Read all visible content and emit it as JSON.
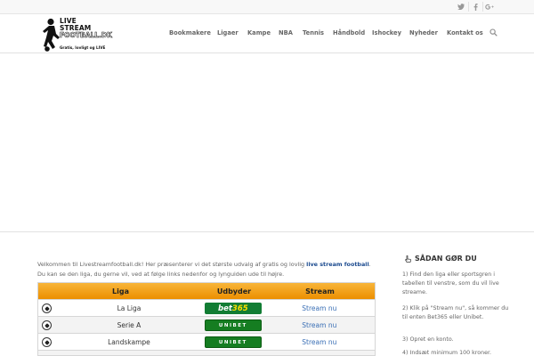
{
  "topbar": {
    "social": [
      {
        "name": "twitter-icon",
        "glyph": "t"
      },
      {
        "name": "facebook-icon",
        "glyph": "f"
      },
      {
        "name": "google-plus-icon",
        "glyph": "g+"
      }
    ]
  },
  "logo": {
    "line1": "LIVE",
    "line2": "STREAM",
    "line3": "FOOTBALL.DK",
    "tagline": "Gratis, lovligt og LIVE"
  },
  "nav": {
    "items": [
      "Bookmakere",
      "Ligaer",
      "Kampe",
      "NBA",
      "Tennis",
      "Håndbold",
      "Ishockey",
      "Nyheder",
      "Kontakt os"
    ]
  },
  "intro": {
    "before": "Velkommen til Livestreamfootball.dk! Her præsenterer vi det største udvalg af gratis og lovlig ",
    "highlight": "live stream football",
    "after": ". Du kan se den liga, du gerne vil, ved at følge links nedenfor og lynguiden ude til højre."
  },
  "table": {
    "headers": [
      "Liga",
      "Udbyder",
      "Stream"
    ],
    "rows": [
      {
        "liga": "La Liga",
        "udbyder": "bet365",
        "stream": "Stream nu"
      },
      {
        "liga": "Serie A",
        "udbyder": "UNIBET",
        "stream": "Stream nu"
      },
      {
        "liga": "Landskampe",
        "udbyder": "UNIBET",
        "stream": "Stream nu"
      }
    ]
  },
  "sidebar": {
    "title": "SÅDAN GØR DU",
    "steps": [
      "1) Find den liga eller sportsgren i tabellen til venstre, som du vil live streame.",
      "2) Klik på \"Stream nu\", så kommer du til enten Bet365 eller Unibet.",
      "3) Opret en konto.",
      "4) Indsæt minimum 100 kroner."
    ]
  },
  "colors": {
    "table_header": "#f29e1a",
    "link": "#3a6fb5",
    "bet365": "#127d34",
    "unibet": "#157d21"
  }
}
